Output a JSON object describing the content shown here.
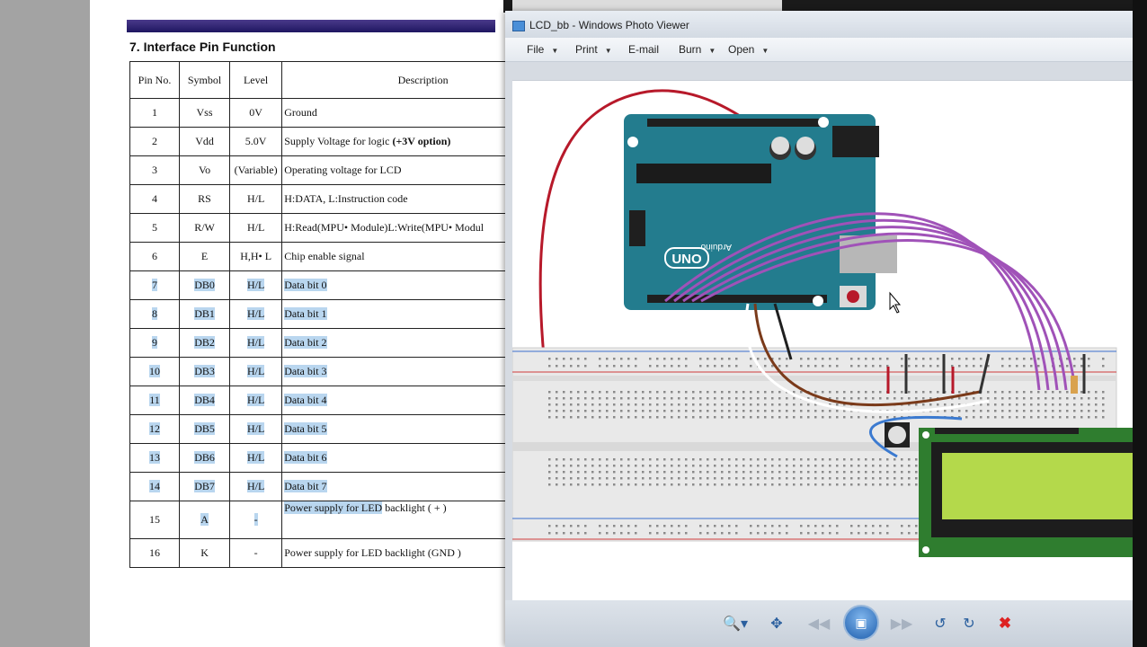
{
  "document": {
    "section_title": "7. Interface Pin Function",
    "columns": [
      "Pin No.",
      "Symbol",
      "Level",
      "Description"
    ],
    "rows": [
      {
        "pin": "1",
        "symbol": "Vss",
        "level": "0V",
        "desc": "Ground"
      },
      {
        "pin": "2",
        "symbol": "Vdd",
        "level": "5.0V",
        "desc_plain": "Supply Voltage for logic ",
        "desc_bold": "(+3V option)"
      },
      {
        "pin": "3",
        "symbol": "Vo",
        "level": "(Variable)",
        "desc": "Operating voltage for LCD"
      },
      {
        "pin": "4",
        "symbol": "RS",
        "level": "H/L",
        "desc": "H:DATA, L:Instruction code"
      },
      {
        "pin": "5",
        "symbol": "R/W",
        "level": "H/L",
        "desc": "H:Read(MPU• Module)L:Write(MPU• Modul"
      },
      {
        "pin": "6",
        "symbol": "E",
        "level": "H,H• L",
        "desc": "Chip enable signal"
      },
      {
        "pin": "7",
        "symbol": "DB0",
        "level": "H/L",
        "desc": "Data bit 0"
      },
      {
        "pin": "8",
        "symbol": "DB1",
        "level": "H/L",
        "desc": "Data bit 1"
      },
      {
        "pin": "9",
        "symbol": "DB2",
        "level": "H/L",
        "desc": "Data bit 2"
      },
      {
        "pin": "10",
        "symbol": "DB3",
        "level": "H/L",
        "desc": "Data bit 3"
      },
      {
        "pin": "11",
        "symbol": "DB4",
        "level": "H/L",
        "desc": "Data bit 4"
      },
      {
        "pin": "12",
        "symbol": "DB5",
        "level": "H/L",
        "desc": "Data bit 5"
      },
      {
        "pin": "13",
        "symbol": "DB6",
        "level": "H/L",
        "desc": "Data bit 6"
      },
      {
        "pin": "14",
        "symbol": "DB7",
        "level": "H/L",
        "desc": "Data bit 7"
      },
      {
        "pin": "15",
        "symbol": "A",
        "level": "-",
        "desc_hl": "Power supply for LED",
        "desc_rest": " backlight ( + )"
      },
      {
        "pin": "16",
        "symbol": "K",
        "level": "-",
        "desc": "Power supply for LED backlight (GND )"
      }
    ],
    "highlight_color": "#b9d6ef"
  },
  "viewer": {
    "title": "LCD_bb - Windows Photo Viewer",
    "menu": {
      "file": "File",
      "print": "Print",
      "email": "E-mail",
      "burn": "Burn",
      "open": "Open"
    },
    "dropdown_arrow": "▼",
    "controls": {
      "zoom": "zoom-icon",
      "actual_size": "actual-size-icon",
      "previous": "previous-icon",
      "slideshow": "slideshow-icon",
      "next": "next-icon",
      "rotate_ccw": "rotate-ccw-icon",
      "rotate_cw": "rotate-cw-icon",
      "delete": "delete-icon"
    }
  },
  "image": {
    "board_labels": {
      "uno": "UNO",
      "brand": "Arduino"
    },
    "colors": {
      "board": "#237c8e",
      "breadboard": "#e9e9e9",
      "lcd_pcb": "#2f7d2f",
      "lcd_screen": "#b4d94b",
      "wire_red": "#b7192a",
      "wire_purple": "#a052b8",
      "wire_brown": "#7a3a1a"
    }
  }
}
